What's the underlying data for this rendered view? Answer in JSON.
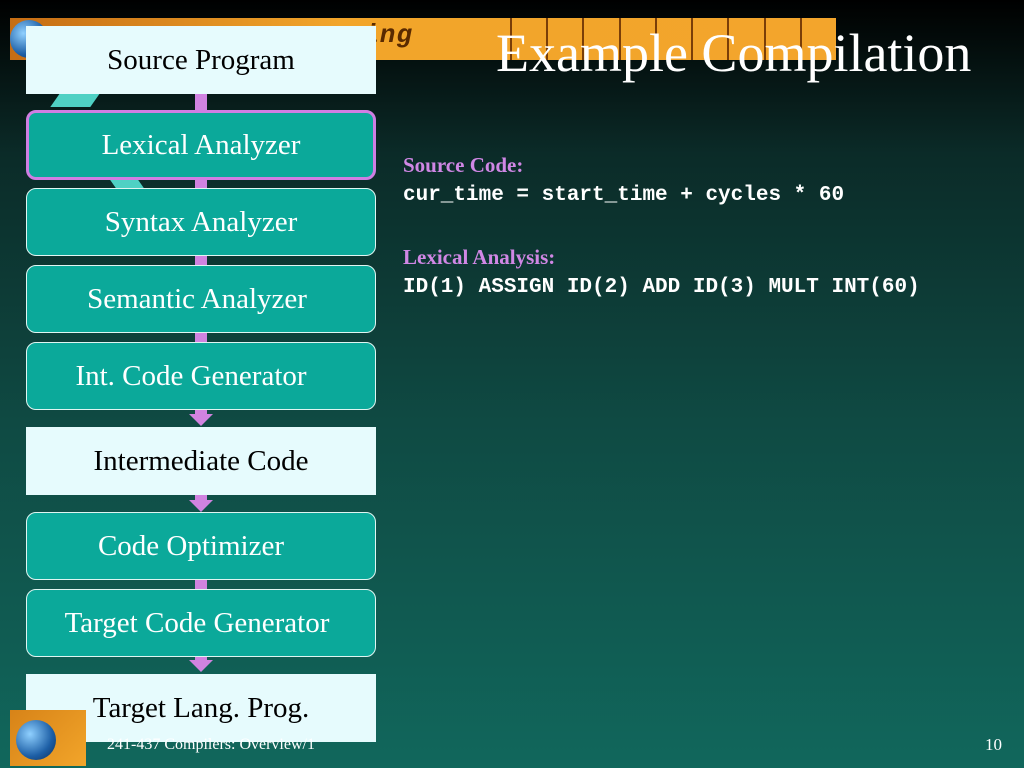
{
  "slide": {
    "title": "Example Compilation",
    "banner_text": "ering"
  },
  "pipeline": [
    {
      "label": "Source Program",
      "kind": "io"
    },
    {
      "label": "Lexical Analyzer",
      "kind": "phase",
      "highlighted": true
    },
    {
      "label": "Syntax Analyzer",
      "kind": "phase"
    },
    {
      "label": "Semantic Analyzer",
      "kind": "phase"
    },
    {
      "label": "Int. Code Generator",
      "kind": "phase"
    },
    {
      "label": "Intermediate Code",
      "kind": "io"
    },
    {
      "label": "Code Optimizer",
      "kind": "phase"
    },
    {
      "label": "Target Code Generator",
      "kind": "phase"
    },
    {
      "label": "Target Lang. Prog.",
      "kind": "io"
    }
  ],
  "content": {
    "source_label": "Source Code:",
    "source_code": "cur_time = start_time + cycles * 60",
    "lexical_label": "Lexical Analysis:",
    "lexical_output": "ID(1) ASSIGN ID(2) ADD ID(3) MULT INT(60)"
  },
  "footer": {
    "course": "241-437 Compilers: Overview/1",
    "page_number": "10"
  },
  "colors": {
    "phase_box": "#0ba99a",
    "io_box": "#e6fbfd",
    "connector": "#d083e0",
    "label_accent": "#d087e5"
  }
}
